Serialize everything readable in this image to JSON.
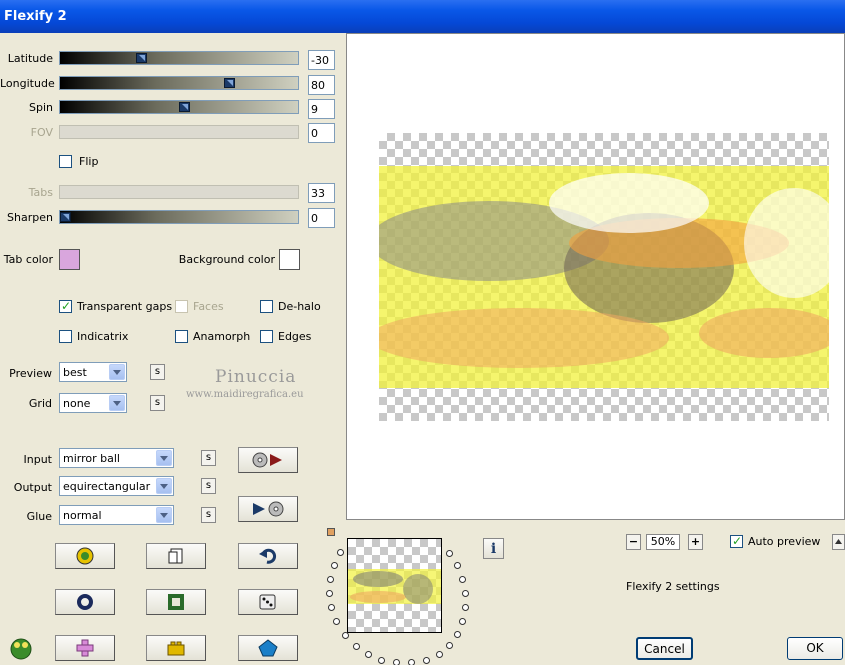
{
  "window": {
    "title": "Flexify 2"
  },
  "sliders": {
    "latitude": {
      "label": "Latitude",
      "value": "-30",
      "level": 0.35
    },
    "longitude": {
      "label": "Longitude",
      "value": "80",
      "level": 0.71
    },
    "spin": {
      "label": "Spin",
      "value": "9",
      "level": 0.52
    },
    "fov": {
      "label": "FOV",
      "value": "0",
      "level": 0
    },
    "tabs": {
      "label": "Tabs",
      "value": "33",
      "level": 0
    },
    "sharpen": {
      "label": "Sharpen",
      "value": "0",
      "level": 0.0
    }
  },
  "flip": {
    "label": "Flip",
    "checked": false
  },
  "colors": {
    "tab_color_label": "Tab color",
    "tab_color": "#d9a6dd",
    "background_color_label": "Background color",
    "background_color": "#ffffff"
  },
  "options": {
    "transparent_gaps": "Transparent gaps",
    "faces": "Faces",
    "dehalo": "De-halo",
    "indicatrix": "Indicatrix",
    "anamorph": "Anamorph",
    "edges": "Edges"
  },
  "preview_select": {
    "label": "Preview",
    "value": "best"
  },
  "grid_select": {
    "label": "Grid",
    "value": "none"
  },
  "sbutton_label": "s",
  "watermark": {
    "name": "Pinuccia",
    "url": "www.maidiregrafica.eu"
  },
  "input_select": {
    "label": "Input",
    "value": "mirror ball"
  },
  "output_select": {
    "label": "Output",
    "value": "equirectangular"
  },
  "glue_select": {
    "label": "Glue",
    "value": "normal"
  },
  "zoom": {
    "minus": "−",
    "value": "50%",
    "plus": "+"
  },
  "auto_preview": {
    "label": "Auto preview",
    "checked": true
  },
  "settings_name": "Flexify 2 settings",
  "buttons": {
    "cancel": "Cancel",
    "ok": "OK"
  },
  "info_icon": "i"
}
